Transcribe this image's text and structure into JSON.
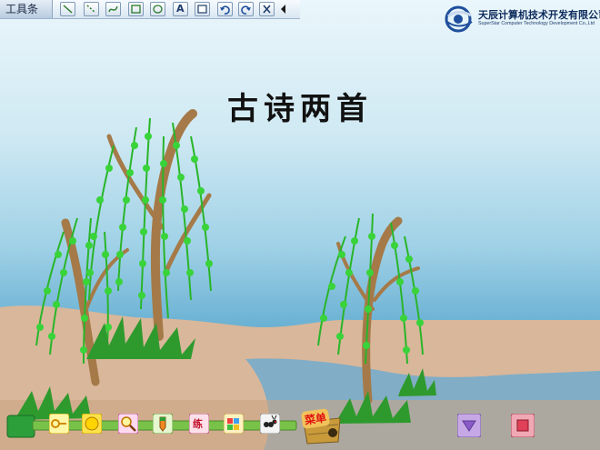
{
  "toolbar": {
    "label": "工具条",
    "tools": [
      {
        "name": "line-tool"
      },
      {
        "name": "dashed-line-tool"
      },
      {
        "name": "freehand-tool"
      },
      {
        "name": "rectangle-tool"
      },
      {
        "name": "ellipse-tool"
      },
      {
        "name": "text-tool",
        "glyph": "A"
      },
      {
        "name": "fill-tool"
      },
      {
        "name": "undo-tool"
      },
      {
        "name": "redo-tool"
      },
      {
        "name": "clear-tool"
      }
    ]
  },
  "logo": {
    "name": "天辰计算机技术开发有限公司",
    "subtitle": "SuperStar Computer Technology Development Co.,Ltd"
  },
  "title": "古诗两首",
  "bottom_bar": {
    "tools": [
      {
        "name": "key-icon"
      },
      {
        "name": "sun-icon"
      },
      {
        "name": "magnifier-icon"
      },
      {
        "name": "pen-icon"
      },
      {
        "name": "practice-icon",
        "label": "练"
      },
      {
        "name": "puzzle-icon"
      },
      {
        "name": "ant-icon"
      }
    ],
    "menu_label": "菜单"
  },
  "colors": {
    "sky_top": "#eaf6fb",
    "water": "#3a8fbf",
    "ground": "#d9b79a",
    "willow_leaf": "#39d33a",
    "trunk": "#a57a48",
    "menu_text": "#e01010"
  }
}
